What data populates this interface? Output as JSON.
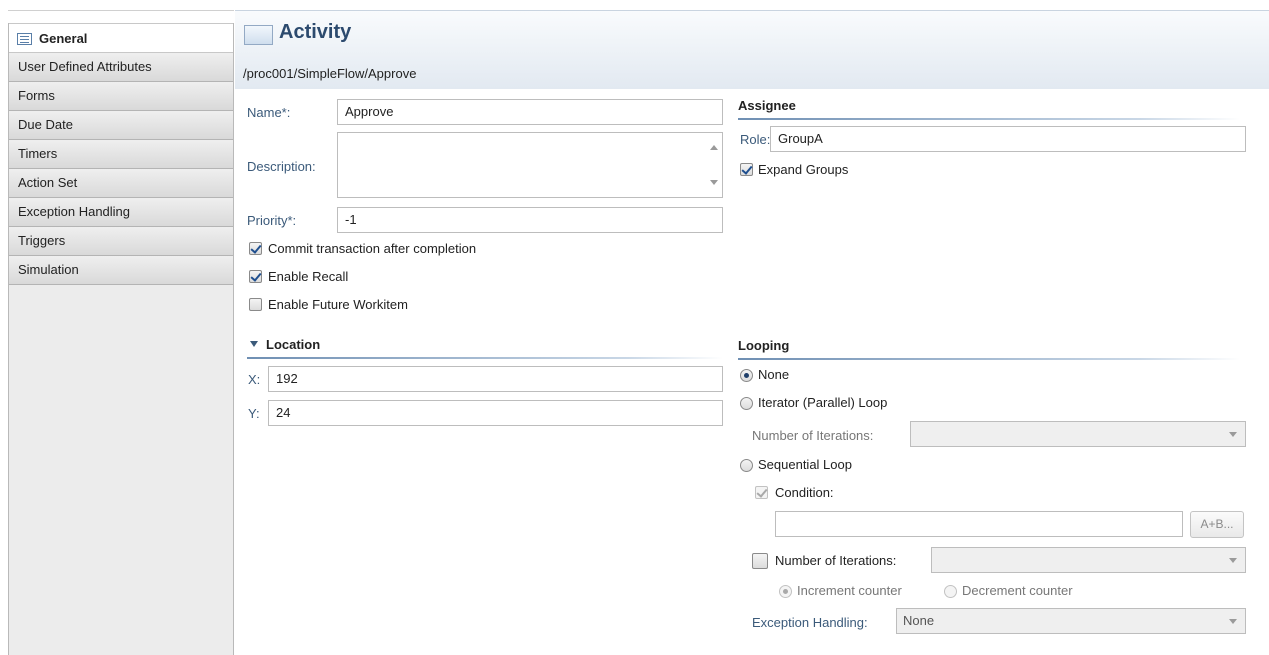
{
  "sidebar": {
    "items": [
      {
        "label": "General"
      },
      {
        "label": "User Defined Attributes"
      },
      {
        "label": "Forms"
      },
      {
        "label": "Due Date"
      },
      {
        "label": "Timers"
      },
      {
        "label": "Action Set"
      },
      {
        "label": "Exception Handling"
      },
      {
        "label": "Triggers"
      },
      {
        "label": "Simulation"
      }
    ]
  },
  "header": {
    "title": "Activity",
    "path": "/proc001/SimpleFlow/Approve"
  },
  "general": {
    "name_label": "Name*:",
    "name_value": "Approve",
    "description_label": "Description:",
    "description_value": "",
    "priority_label": "Priority*:",
    "priority_value": "-1",
    "commit_label": "Commit transaction after completion",
    "commit_checked": true,
    "recall_label": "Enable Recall",
    "recall_checked": true,
    "future_label": "Enable Future Workitem",
    "future_checked": false
  },
  "assignee": {
    "title": "Assignee",
    "role_label": "Role:",
    "role_value": "GroupA",
    "expand_label": "Expand Groups",
    "expand_checked": true
  },
  "location": {
    "title": "Location",
    "x_label": "X:",
    "x_value": "192",
    "y_label": "Y:",
    "y_value": "24"
  },
  "looping": {
    "title": "Looping",
    "none_label": "None",
    "iterator_label": "Iterator (Parallel) Loop",
    "iterations_label": "Number of Iterations:",
    "iterations_value": "",
    "sequential_label": "Sequential Loop",
    "condition_label": "Condition:",
    "condition_value": "",
    "expr_button": "A+B...",
    "seq_iterations_label": "Number of Iterations:",
    "seq_iterations_value": "",
    "increment_label": "Increment counter",
    "decrement_label": "Decrement counter",
    "exception_label": "Exception Handling:",
    "exception_value": "None",
    "selected": "None"
  },
  "colors": {
    "label_blue": "#3b5a7a",
    "title_blue": "#2c4a6e"
  }
}
